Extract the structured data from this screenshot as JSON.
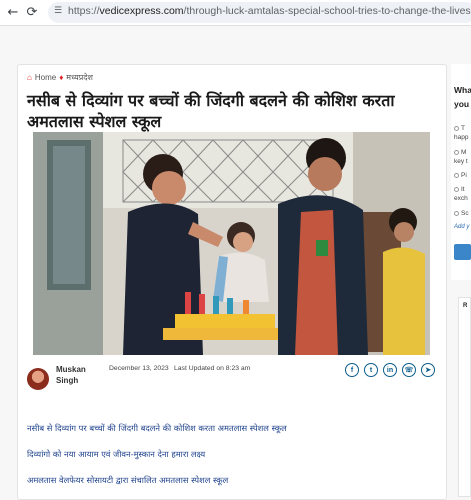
{
  "browser": {
    "url_prefix": "https://",
    "url_domain": "vedicexpress.com",
    "url_path": "/through-luck-amtalas-special-school-tries-to-change-the-lives..."
  },
  "breadcrumb": {
    "home": "Home",
    "category": "मध्यप्रदेश"
  },
  "article": {
    "title": "नसीब से दिव्यांग पर बच्चों की जिंदगी बदलने की कोशिश करता अमतलास स्पेशल स्कूल",
    "author_first": "Muskan",
    "author_last": "Singh",
    "date": "December 13, 2023",
    "updated": "Last Updated on 8:23 am",
    "share_icons": [
      "facebook-icon",
      "twitter-icon",
      "linkedin-icon",
      "whatsapp-icon",
      "telegram-icon"
    ],
    "toc": [
      "नसीब से दिव्यांग पर बच्चों की जिंदगी बदलने की कोशिश करता अमतलास स्पेशल स्कूल",
      "दिव्यांगो को नया आयाम एवं जीवन-मुस्कान देना हमारा लक्ष्य",
      "अमलतास वेलफेयर सोसायटी द्वारा संचालित अमतलास स्पेशल स्कूल"
    ]
  },
  "sidebar": {
    "title_line1": "Wha",
    "title_line2": "you",
    "options": [
      "T",
      "happ",
      "M",
      "key t",
      "Pi",
      "It",
      "exch",
      "Sc"
    ],
    "link": "Add y",
    "card_label": "R"
  },
  "colors": {
    "accent": "#d22222",
    "link": "#1b3f8a",
    "share": "#0b5d8c",
    "button": "#3a86c8"
  }
}
